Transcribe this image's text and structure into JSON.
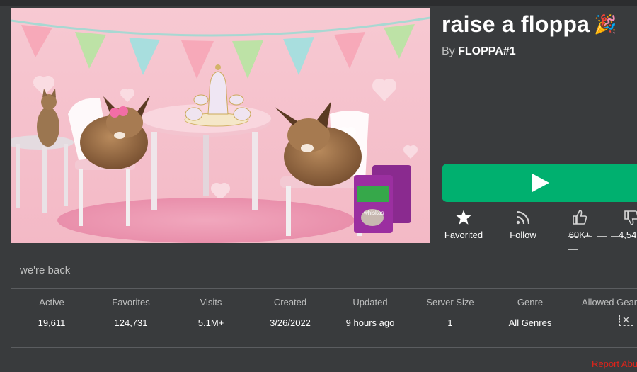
{
  "game": {
    "title": "raise a floppa",
    "title_emoji": "🎉",
    "by_prefix": "By",
    "creator": "FLOPPA#1",
    "description": "we're back"
  },
  "actions": {
    "favorite_label": "Favorited",
    "follow_label": "Follow",
    "upvotes": "60K+",
    "downvotes": "4,54"
  },
  "stats": [
    {
      "label": "Active",
      "value": "19,611"
    },
    {
      "label": "Favorites",
      "value": "124,731"
    },
    {
      "label": "Visits",
      "value": "5.1M+"
    },
    {
      "label": "Created",
      "value": "3/26/2022"
    },
    {
      "label": "Updated",
      "value": "9 hours ago"
    },
    {
      "label": "Server Size",
      "value": "1"
    },
    {
      "label": "Genre",
      "value": "All Genres"
    },
    {
      "label": "Allowed Gear",
      "value": ""
    }
  ],
  "thumbnail": {
    "bag_brand": "whiskas"
  },
  "report_label": "Report Abuse",
  "colors": {
    "play_green": "#00b06f",
    "background": "#393b3d",
    "report_red": "#e2231a"
  },
  "icons": [
    "play-icon",
    "star-icon",
    "rss-icon",
    "thumbs-up-icon",
    "thumbs-down-icon",
    "gear-blocked-icon"
  ]
}
